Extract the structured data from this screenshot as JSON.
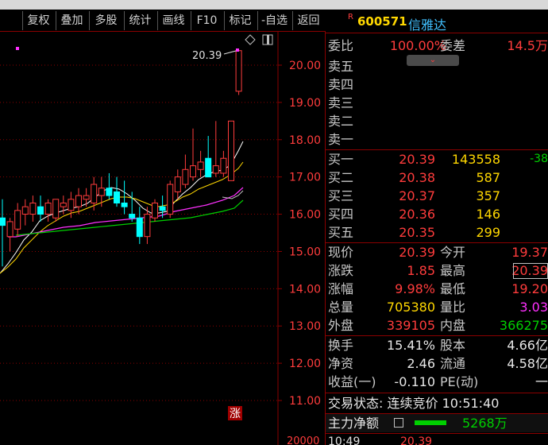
{
  "toolbar": {
    "buttons": [
      "复权",
      "叠加",
      "多股",
      "统计",
      "画线",
      "F10",
      "标记",
      "-自选",
      "返回"
    ]
  },
  "quote_header": {
    "flag": "R",
    "code": "600571",
    "name": "信雅达"
  },
  "chart": {
    "price_labels": [
      "20.00",
      "19.00",
      "18.00",
      "17.00",
      "16.00",
      "15.00",
      "14.00",
      "13.00",
      "12.00",
      "11.00"
    ],
    "volume_label": "20000",
    "high_marker": "20.39",
    "limit_up_tag": "涨"
  },
  "book": {
    "ratio": {
      "label": "委比",
      "value": "100.00%",
      "label2": "委差",
      "value2": "14.5万"
    },
    "sells": [
      {
        "label": "卖五"
      },
      {
        "label": "卖四"
      },
      {
        "label": "卖三"
      },
      {
        "label": "卖二"
      },
      {
        "label": "卖一"
      }
    ],
    "buys": [
      {
        "label": "买一",
        "price": "20.39",
        "vol": "143558",
        "chg": "-38"
      },
      {
        "label": "买二",
        "price": "20.38",
        "vol": "587"
      },
      {
        "label": "买三",
        "price": "20.37",
        "vol": "357"
      },
      {
        "label": "买四",
        "price": "20.36",
        "vol": "146"
      },
      {
        "label": "买五",
        "price": "20.35",
        "vol": "299"
      }
    ]
  },
  "stats": [
    {
      "l1": "现价",
      "v1": "20.39",
      "l2": "今开",
      "v2": "19.37"
    },
    {
      "l1": "涨跌",
      "v1": "1.85",
      "l2": "最高",
      "v2": "20.39"
    },
    {
      "l1": "涨幅",
      "v1": "9.98%",
      "l2": "最低",
      "v2": "19.20"
    },
    {
      "l1": "总量",
      "v1": "705380",
      "l2": "量比",
      "v2": "3.03"
    },
    {
      "l1": "外盘",
      "v1": "339105",
      "l2": "内盘",
      "v2": "366275"
    }
  ],
  "fund": [
    {
      "l1": "换手",
      "v1": "15.41%",
      "l2": "股本",
      "v2": "4.66亿"
    },
    {
      "l1": "净资",
      "v1": "2.46",
      "l2": "流通",
      "v2": "4.58亿"
    },
    {
      "l1": "收益(一)",
      "v1": "-0.110",
      "l2": "PE(动)",
      "v2": "一"
    }
  ],
  "trade_status": "交易状态: 连续竞价 10:51:40",
  "main_force": {
    "label": "主力净额",
    "value": "5268万"
  },
  "bottom_tick": {
    "time": "10:49",
    "price": "20.39"
  },
  "colors": {
    "up": "#ff3c3c",
    "down": "#00ffff",
    "volume": "#ffd700",
    "ma5": "#ffffff",
    "ma10": "#ffd700",
    "ma20": "#ff30ff",
    "ma60": "#00d000",
    "grid": "#8b0000"
  },
  "chart_data": {
    "type": "candlestick",
    "price_axis": {
      "min": 11.0,
      "max": 20.0,
      "ticks": [
        20,
        19,
        18,
        17,
        16,
        15,
        14,
        13,
        12,
        11
      ]
    },
    "candles": [
      {
        "o": 15.9,
        "h": 16.4,
        "l": 14.6,
        "c": 15.7
      },
      {
        "o": 15.4,
        "h": 15.9,
        "l": 15.0,
        "c": 15.8
      },
      {
        "o": 15.6,
        "h": 16.3,
        "l": 15.4,
        "c": 16.1
      },
      {
        "o": 16.0,
        "h": 16.4,
        "l": 15.7,
        "c": 16.2
      },
      {
        "o": 16.0,
        "h": 16.5,
        "l": 15.8,
        "c": 16.3
      },
      {
        "o": 16.2,
        "h": 16.5,
        "l": 15.8,
        "c": 16.0
      },
      {
        "o": 16.0,
        "h": 16.4,
        "l": 15.8,
        "c": 16.3
      },
      {
        "o": 15.9,
        "h": 16.4,
        "l": 15.8,
        "c": 16.4
      },
      {
        "o": 16.2,
        "h": 16.5,
        "l": 16.0,
        "c": 16.3
      },
      {
        "o": 16.1,
        "h": 16.6,
        "l": 15.9,
        "c": 16.4
      },
      {
        "o": 16.2,
        "h": 16.7,
        "l": 16.0,
        "c": 16.5
      },
      {
        "o": 16.4,
        "h": 16.7,
        "l": 16.2,
        "c": 16.5
      },
      {
        "o": 16.3,
        "h": 17.0,
        "l": 16.1,
        "c": 16.8
      },
      {
        "o": 16.5,
        "h": 17.0,
        "l": 16.2,
        "c": 16.7
      },
      {
        "o": 16.7,
        "h": 17.1,
        "l": 16.4,
        "c": 16.5
      },
      {
        "o": 16.6,
        "h": 17.0,
        "l": 16.2,
        "c": 16.3
      },
      {
        "o": 16.3,
        "h": 16.9,
        "l": 16.0,
        "c": 16.2
      },
      {
        "o": 16.0,
        "h": 16.6,
        "l": 15.8,
        "c": 15.9
      },
      {
        "o": 15.9,
        "h": 16.2,
        "l": 15.2,
        "c": 15.4
      },
      {
        "o": 15.4,
        "h": 16.2,
        "l": 15.2,
        "c": 16.0
      },
      {
        "o": 15.9,
        "h": 16.4,
        "l": 15.8,
        "c": 16.3
      },
      {
        "o": 16.2,
        "h": 16.5,
        "l": 15.9,
        "c": 16.1
      },
      {
        "o": 16.0,
        "h": 16.9,
        "l": 15.9,
        "c": 16.8
      },
      {
        "o": 16.6,
        "h": 17.2,
        "l": 16.4,
        "c": 17.0
      },
      {
        "o": 16.8,
        "h": 17.6,
        "l": 16.7,
        "c": 17.2
      },
      {
        "o": 17.0,
        "h": 18.3,
        "l": 16.9,
        "c": 17.3
      },
      {
        "o": 17.2,
        "h": 17.7,
        "l": 17.0,
        "c": 17.4
      },
      {
        "o": 17.5,
        "h": 18.1,
        "l": 17.1,
        "c": 17.0
      },
      {
        "o": 17.1,
        "h": 18.5,
        "l": 17.0,
        "c": 17.3
      },
      {
        "o": 17.1,
        "h": 17.7,
        "l": 17.0,
        "c": 17.5
      },
      {
        "o": 16.9,
        "h": 18.5,
        "l": 16.9,
        "c": 18.5
      },
      {
        "o": 19.3,
        "h": 20.4,
        "l": 19.2,
        "c": 20.39
      }
    ]
  }
}
